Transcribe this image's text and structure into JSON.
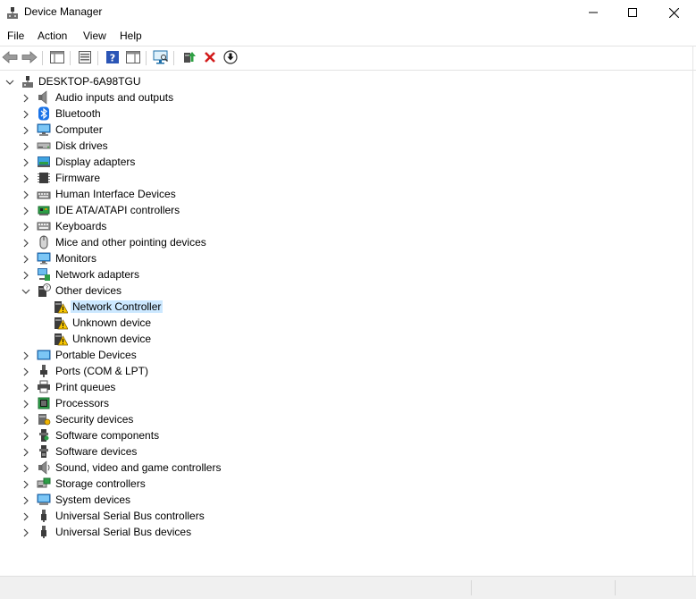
{
  "window": {
    "title": "Device Manager",
    "minimize_icon": "minimize-icon",
    "maximize_icon": "maximize-icon",
    "close_icon": "close-icon"
  },
  "menu": [
    "File",
    "Action",
    "View",
    "Help"
  ],
  "toolbar": [
    "back-arrow-icon",
    "forward-arrow-icon",
    "show-hide-console-tree-icon",
    "properties-icon",
    "help-icon",
    "action-pane-icon",
    "scan-hardware-icon",
    "update-driver-icon",
    "uninstall-device-icon",
    "disable-device-icon"
  ],
  "tree": {
    "root": "DESKTOP-6A98TGU",
    "categories": [
      {
        "label": "Audio inputs and outputs",
        "icon": "speaker-icon"
      },
      {
        "label": "Bluetooth",
        "icon": "bluetooth-icon"
      },
      {
        "label": "Computer",
        "icon": "computer-icon"
      },
      {
        "label": "Disk drives",
        "icon": "disk-drive-icon"
      },
      {
        "label": "Display adapters",
        "icon": "display-adapter-icon"
      },
      {
        "label": "Firmware",
        "icon": "chip-icon"
      },
      {
        "label": "Human Interface Devices",
        "icon": "hid-icon"
      },
      {
        "label": "IDE ATA/ATAPI controllers",
        "icon": "ide-controller-icon"
      },
      {
        "label": "Keyboards",
        "icon": "keyboard-icon"
      },
      {
        "label": "Mice and other pointing devices",
        "icon": "mouse-icon"
      },
      {
        "label": "Monitors",
        "icon": "monitor-icon"
      },
      {
        "label": "Network adapters",
        "icon": "network-adapter-icon"
      },
      {
        "label": "Other devices",
        "icon": "unknown-device-icon",
        "expanded": true,
        "children": [
          {
            "label": "Network Controller",
            "icon": "warning-device-icon",
            "selected": true
          },
          {
            "label": "Unknown device",
            "icon": "warning-device-icon"
          },
          {
            "label": "Unknown device",
            "icon": "warning-device-icon"
          }
        ]
      },
      {
        "label": "Portable Devices",
        "icon": "portable-device-icon"
      },
      {
        "label": "Ports (COM & LPT)",
        "icon": "port-icon"
      },
      {
        "label": "Print queues",
        "icon": "printer-icon"
      },
      {
        "label": "Processors",
        "icon": "processor-icon"
      },
      {
        "label": "Security devices",
        "icon": "security-device-icon"
      },
      {
        "label": "Software components",
        "icon": "software-component-icon"
      },
      {
        "label": "Software devices",
        "icon": "software-device-icon"
      },
      {
        "label": "Sound, video and game controllers",
        "icon": "sound-icon"
      },
      {
        "label": "Storage controllers",
        "icon": "storage-controller-icon"
      },
      {
        "label": "System devices",
        "icon": "system-device-icon"
      },
      {
        "label": "Universal Serial Bus controllers",
        "icon": "usb-icon"
      },
      {
        "label": "Universal Serial Bus devices",
        "icon": "usb-icon"
      }
    ]
  },
  "colors": {
    "selection": "#cce8ff",
    "accent_blue": "#0078d7",
    "error_red": "#e81123",
    "warning_yellow": "#f7c600"
  }
}
